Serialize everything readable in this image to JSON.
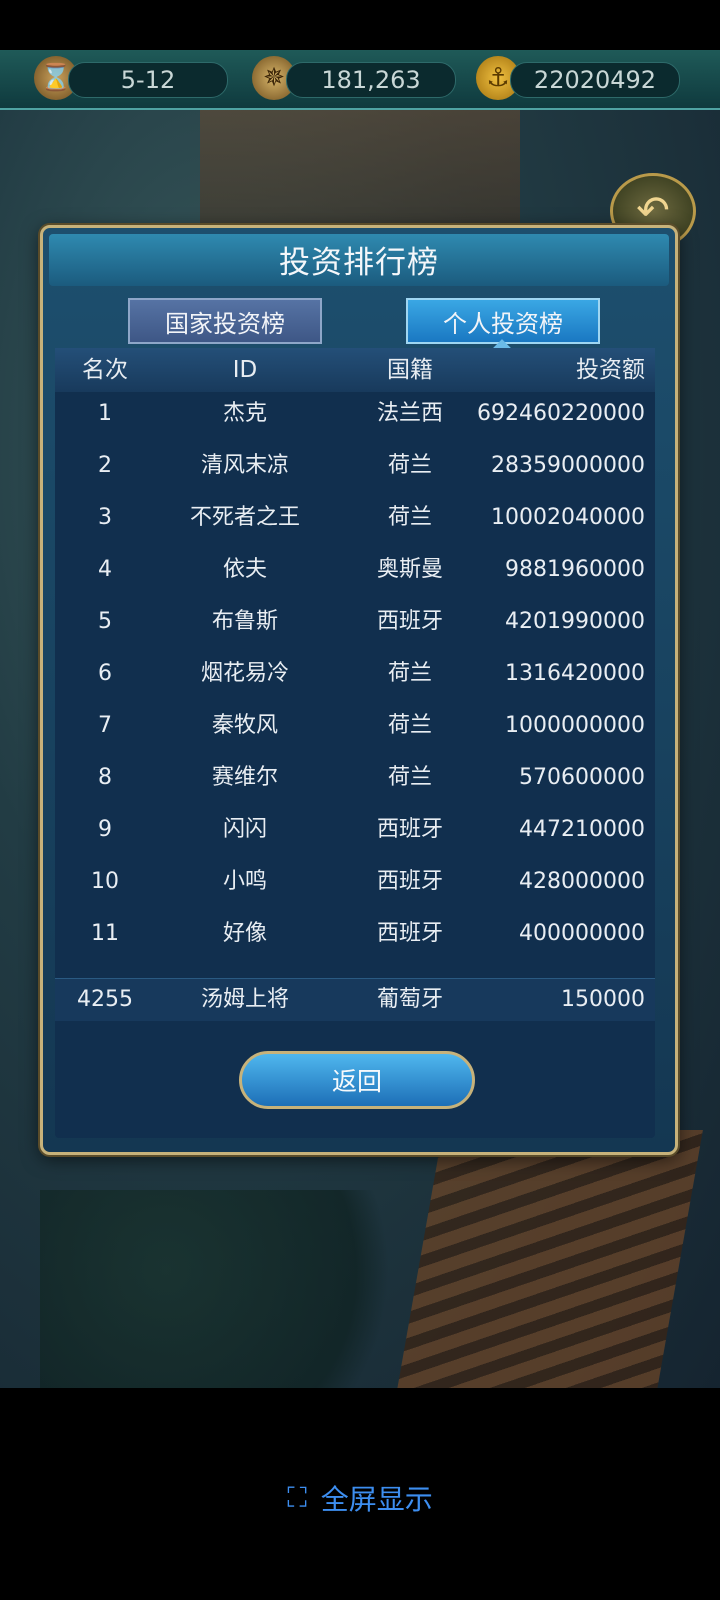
{
  "topbar": {
    "date": "5-12",
    "points": "181,263",
    "gold": "22020492",
    "icons": [
      "hourglass-icon",
      "compass-icon",
      "anchor-coin-icon"
    ]
  },
  "dialog": {
    "title": "投资排行榜",
    "tabs": [
      {
        "label": "国家投资榜",
        "active": false
      },
      {
        "label": "个人投资榜",
        "active": true
      }
    ],
    "columns": [
      "名次",
      "ID",
      "国籍",
      "投资额"
    ],
    "rows": [
      {
        "rank": "1",
        "id": "杰克",
        "nation": "法兰西",
        "amount": "692460220000"
      },
      {
        "rank": "2",
        "id": "清风末凉",
        "nation": "荷兰",
        "amount": "28359000000"
      },
      {
        "rank": "3",
        "id": "不死者之王",
        "nation": "荷兰",
        "amount": "10002040000"
      },
      {
        "rank": "4",
        "id": "依夫",
        "nation": "奥斯曼",
        "amount": "9881960000"
      },
      {
        "rank": "5",
        "id": "布鲁斯",
        "nation": "西班牙",
        "amount": "4201990000"
      },
      {
        "rank": "6",
        "id": "烟花易冷",
        "nation": "荷兰",
        "amount": "1316420000"
      },
      {
        "rank": "7",
        "id": "秦牧风",
        "nation": "荷兰",
        "amount": "1000000000"
      },
      {
        "rank": "8",
        "id": "赛维尔",
        "nation": "荷兰",
        "amount": "570600000"
      },
      {
        "rank": "9",
        "id": "闪闪",
        "nation": "西班牙",
        "amount": "447210000"
      },
      {
        "rank": "10",
        "id": "小鸣",
        "nation": "西班牙",
        "amount": "428000000"
      },
      {
        "rank": "11",
        "id": "好像",
        "nation": "西班牙",
        "amount": "400000000"
      }
    ],
    "my_row": {
      "rank": "4255",
      "id": "汤姆上将",
      "nation": "葡萄牙",
      "amount": "150000"
    },
    "return_label": "返回"
  },
  "fullscreen_label": "全屏显示",
  "colors": {
    "accent": "#3d8ef0",
    "gold_border": "#c7b27a",
    "active_tab": "#2a8fd8"
  }
}
